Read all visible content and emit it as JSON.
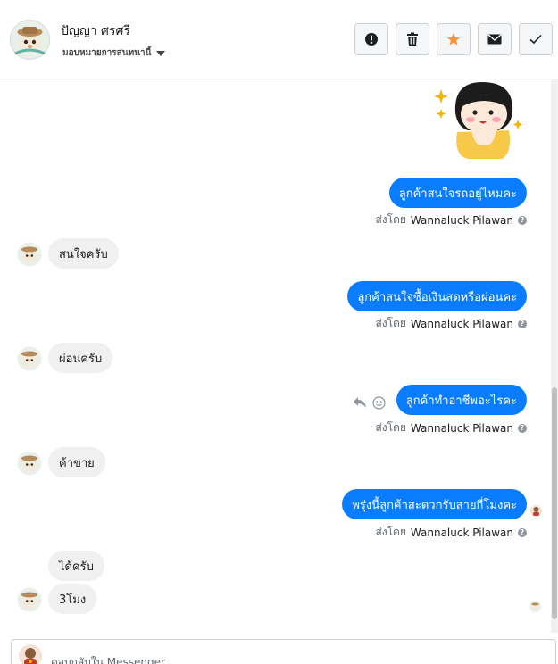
{
  "header": {
    "name": "ปัญญา ศรศรี",
    "assign_label": "มอบหมายการสนทนานี้",
    "actions": [
      "mark-spam",
      "delete",
      "star",
      "mark-unread",
      "mark-done"
    ]
  },
  "messages": [
    {
      "dir": "out",
      "kind": "sticker"
    },
    {
      "dir": "out",
      "text": "ลูกค้าสนใจรถอยู่ไหมคะ",
      "sent_by_prefix": "ส่งโดย",
      "sent_by": "Wannaluck Pilawan"
    },
    {
      "dir": "in",
      "text": "สนใจครับ"
    },
    {
      "dir": "out",
      "text": "ลูกค้าสนใจซื้อเงินสดหรือผ่อนคะ",
      "sent_by_prefix": "ส่งโดย",
      "sent_by": "Wannaluck Pilawan"
    },
    {
      "dir": "in",
      "text": "ผ่อนครับ"
    },
    {
      "dir": "out",
      "text": "ลูกค้าทำอาชีพอะไรคะ",
      "sent_by_prefix": "ส่งโดย",
      "sent_by": "Wannaluck Pilawan"
    },
    {
      "dir": "in",
      "text": "ค้าขาย"
    },
    {
      "dir": "out",
      "text": "พรุ่งนี้ลูกค้าสะดวกรับสายกี่โมงคะ",
      "sent_by_prefix": "ส่งโดย",
      "sent_by": "Wannaluck Pilawan"
    },
    {
      "dir": "in",
      "text": "ได้ครับ"
    },
    {
      "dir": "in",
      "text": "3โมง"
    }
  ],
  "composer": {
    "placeholder": "ตอบกลับใน Messenger..."
  },
  "colors": {
    "outgoing_bubble": "#0a7cff",
    "incoming_bubble": "#f0f0f0",
    "star_active": "#f7923a"
  }
}
